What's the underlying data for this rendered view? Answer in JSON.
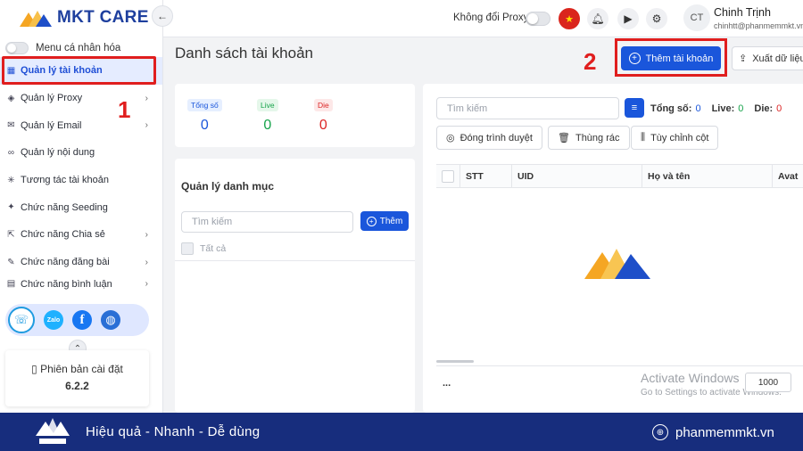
{
  "app": {
    "logo_text": "MKT CARE"
  },
  "sidebar": {
    "menu_toggle_label": "Menu cá nhân hóa",
    "items": [
      {
        "label": "Quản lý tài khoản",
        "icon": "grid-icon",
        "chevron": false,
        "active": true
      },
      {
        "label": "Quản lý Proxy",
        "icon": "layers-icon",
        "chevron": true
      },
      {
        "label": "Quản lý Email",
        "icon": "mail-icon",
        "chevron": true
      },
      {
        "label": "Quản lý nội dung",
        "icon": "link-icon",
        "chevron": false
      },
      {
        "label": "Tương tác tài khoản",
        "icon": "sparkle-icon",
        "chevron": false
      },
      {
        "label": "Chức năng Seeding",
        "icon": "seed-icon",
        "chevron": false
      },
      {
        "label": "Chức năng Chia sẻ",
        "icon": "share-icon",
        "chevron": true
      },
      {
        "label": "Chức năng đăng bài",
        "icon": "edit-icon",
        "chevron": true
      },
      {
        "label": "Chức năng bình luận",
        "icon": "comment-icon",
        "chevron": true
      }
    ],
    "social": {
      "zalo_label": "Zalo",
      "facebook_label": "f"
    },
    "version": {
      "label": "Phiên bản cài đặt",
      "number": "6.2.2"
    }
  },
  "header": {
    "proxy_label": "Không đổi Proxy",
    "user": {
      "initials": "CT",
      "name": "Chinh Trịnh",
      "email": "chinhtt@phanmemmkt.vn"
    }
  },
  "main": {
    "title": "Danh sách tài khoản",
    "add_account_label": "Thêm tài khoản",
    "export_label": "Xuất dữ liệu",
    "stats": [
      {
        "label": "Tổng số",
        "value": "0",
        "color": "#1a56db",
        "bg": "#e6efff"
      },
      {
        "label": "Live",
        "value": "0",
        "color": "#16a34a",
        "bg": "#e5f7ea"
      },
      {
        "label": "Die",
        "value": "0",
        "color": "#dc2626",
        "bg": "#fde8e8"
      }
    ],
    "category": {
      "title": "Quản lý danh mục",
      "search_placeholder": "Tìm kiếm",
      "add_label": "Thêm",
      "all_label": "Tất cả"
    },
    "table": {
      "search_placeholder": "Tìm kiếm",
      "count_total_label": "Tổng số:",
      "count_total": "0",
      "count_live_label": "Live:",
      "count_live": "0",
      "count_die_label": "Die:",
      "count_die": "0",
      "buttons": [
        "Đóng trình duyệt",
        "Thùng rác",
        "Tùy chỉnh cột"
      ],
      "columns": [
        "STT",
        "UID",
        "Họ và tên",
        "Avat"
      ],
      "footer_ellipsis": "...",
      "page_size": "1000"
    },
    "annotations": {
      "one": "1",
      "two": "2"
    }
  },
  "watermark": {
    "line1": "Activate Windows",
    "line2": "Go to Settings to activate Windows."
  },
  "footer": {
    "slogan": "Hiệu quả - Nhanh - Dễ dùng",
    "site": "phanmemmkt.vn"
  },
  "colors": {
    "primary": "#1a56db",
    "annotation_red": "#e01e1e",
    "footer_bg": "#172d7d",
    "active_bg": "#e5ecff"
  }
}
